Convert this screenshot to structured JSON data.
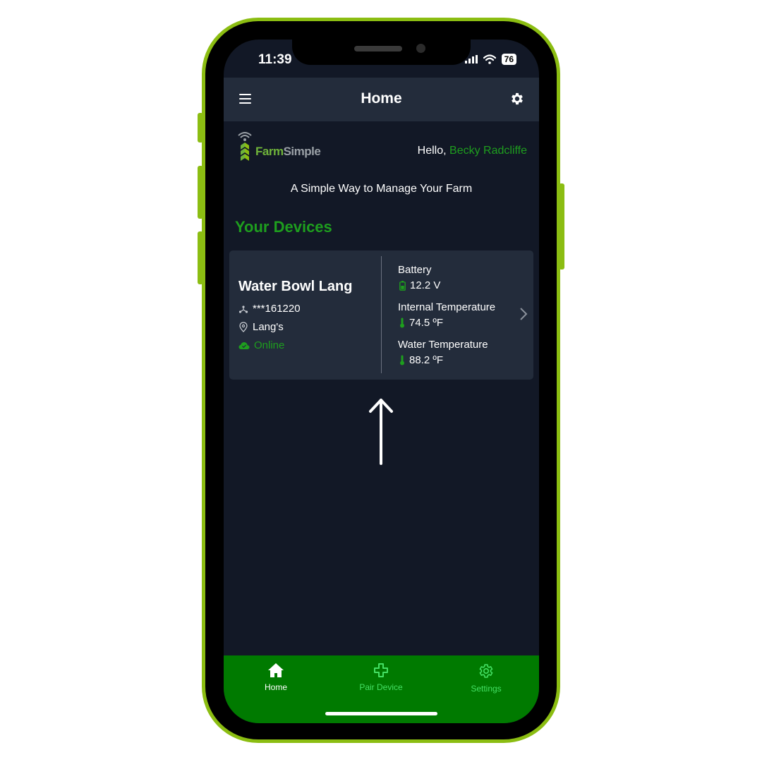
{
  "status_bar": {
    "time": "11:39",
    "battery": "76"
  },
  "header": {
    "title": "Home"
  },
  "brand": {
    "logo_text_part1": "Farm",
    "logo_text_part2": "Simple"
  },
  "greeting": {
    "prefix": "Hello, ",
    "name": "Becky Radcliffe"
  },
  "tagline": "A Simple Way to Manage Your Farm",
  "section_title": "Your Devices",
  "device": {
    "name": "Water Bowl Lang",
    "id": "***161220",
    "location": "Lang's",
    "status": "Online",
    "metrics": [
      {
        "label": "Battery",
        "value": "12.2 V",
        "icon": "battery-icon"
      },
      {
        "label": "Internal Temperature",
        "value": "74.5 ºF",
        "icon": "thermometer-icon"
      },
      {
        "label": "Water Temperature",
        "value": "88.2 ºF",
        "icon": "thermometer-icon"
      }
    ]
  },
  "bottom_nav": {
    "items": [
      {
        "label": "Home",
        "icon": "home-icon",
        "active": true
      },
      {
        "label": "Pair Device",
        "icon": "plus-icon",
        "active": false
      },
      {
        "label": "Settings",
        "icon": "gear-icon",
        "active": false
      }
    ]
  },
  "colors": {
    "accent": "#1e9e1e",
    "nav_background": "#007a00",
    "screen_background": "#121826",
    "card_background": "#232c3b",
    "frame": "#8bbd12"
  }
}
